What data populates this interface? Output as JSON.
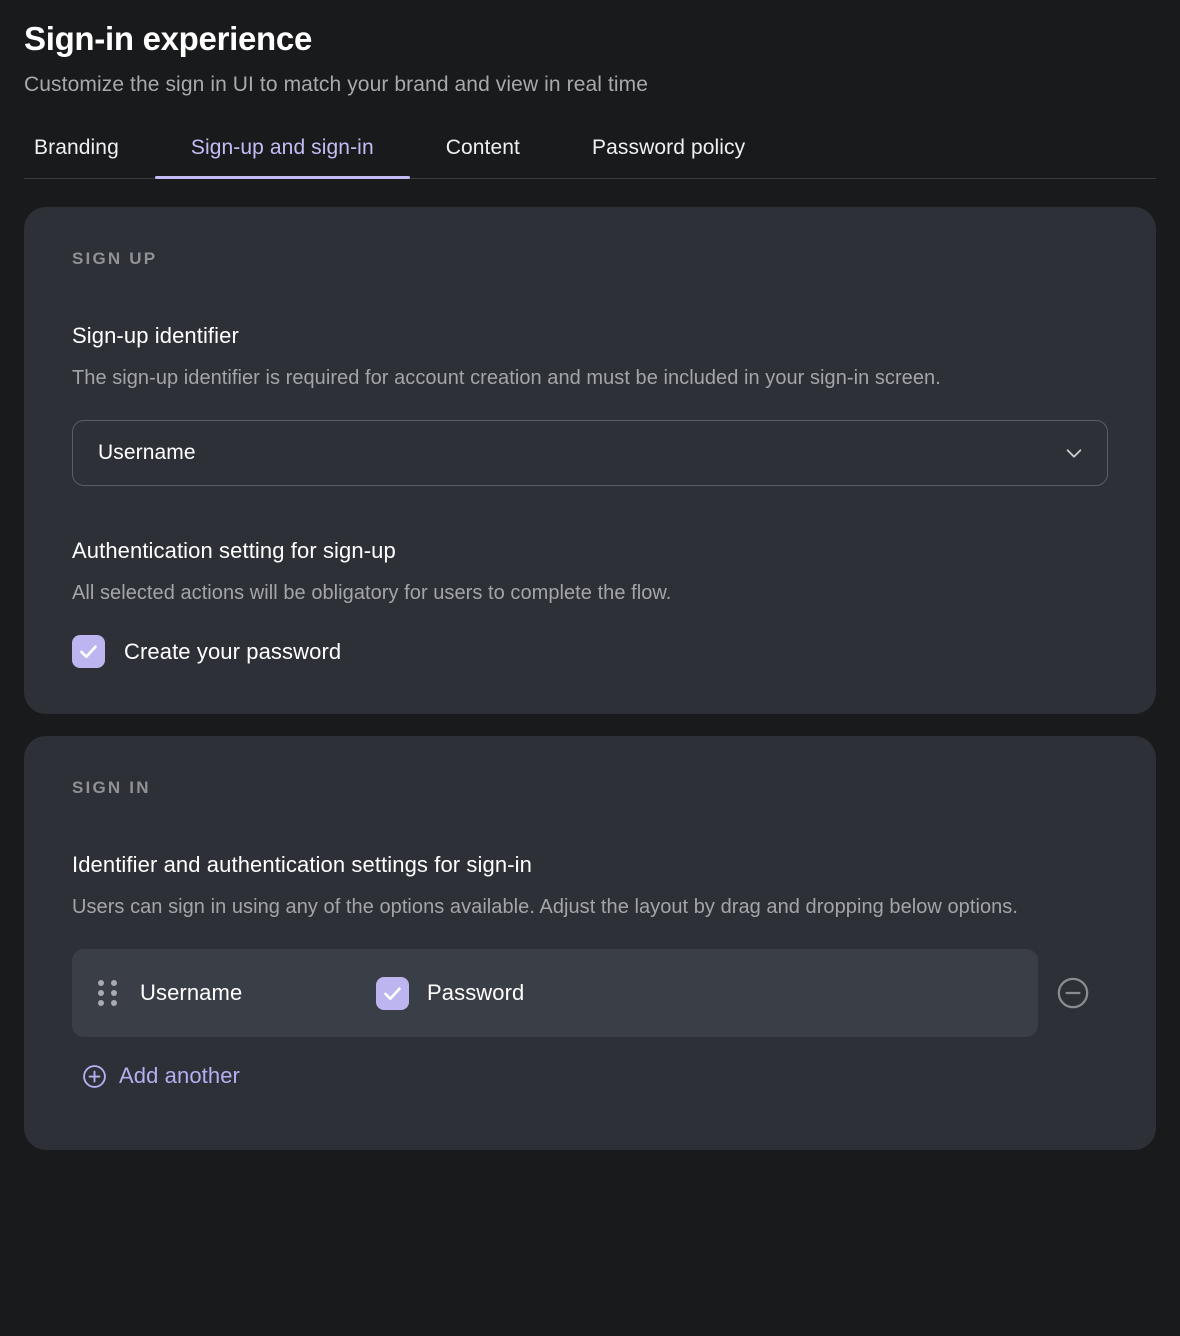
{
  "header": {
    "title": "Sign-in experience",
    "subtitle": "Customize the sign in UI to match your brand and view in real time"
  },
  "tabs": [
    {
      "label": "Branding",
      "active": false
    },
    {
      "label": "Sign-up and sign-in",
      "active": true
    },
    {
      "label": "Content",
      "active": false
    },
    {
      "label": "Password policy",
      "active": false
    }
  ],
  "signup": {
    "section_label": "SIGN UP",
    "identifier": {
      "title": "Sign-up identifier",
      "description": "The sign-up identifier is required for account creation and must be included in your sign-in screen.",
      "selected_value": "Username",
      "chevron_icon": "chevron-down-icon"
    },
    "auth_setting": {
      "title": "Authentication setting for sign-up",
      "description": "All selected actions will be obligatory for users to complete the flow.",
      "options": [
        {
          "label": "Create your password",
          "checked": true
        }
      ]
    }
  },
  "signin": {
    "section_label": "SIGN IN",
    "settings": {
      "title": "Identifier and authentication settings for sign-in",
      "description": "Users can sign in using any of the options available. Adjust the layout by drag and dropping below options."
    },
    "rows": [
      {
        "drag_icon": "drag-handle-icon",
        "identifier": "Username",
        "auth_label": "Password",
        "auth_checked": true,
        "remove_icon": "circle-minus-icon"
      }
    ],
    "add_another": {
      "label": "Add another",
      "icon": "circle-plus-icon"
    }
  },
  "colors": {
    "page_bg": "#191a1c",
    "panel_bg": "#2d3036",
    "row_bg": "#3a3e46",
    "accent": "#c3bdf5",
    "checkbox": "#bdb5f0",
    "muted_text": "#a3a5aa",
    "section_label": "#8f9197"
  }
}
